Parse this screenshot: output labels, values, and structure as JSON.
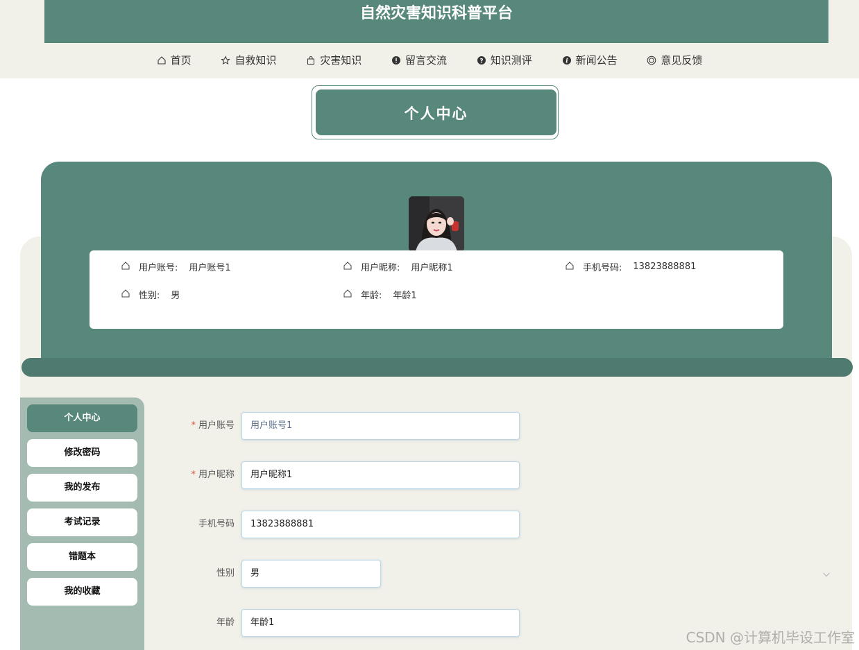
{
  "app": {
    "title": "自然灾害知识科普平台"
  },
  "nav": {
    "items": [
      {
        "label": "首页",
        "icon": "home-icon"
      },
      {
        "label": "自救知识",
        "icon": "star-icon"
      },
      {
        "label": "灾害知识",
        "icon": "bag-icon"
      },
      {
        "label": "留言交流",
        "icon": "alert-icon"
      },
      {
        "label": "知识测评",
        "icon": "help-icon"
      },
      {
        "label": "新闻公告",
        "icon": "info-icon"
      },
      {
        "label": "意见反馈",
        "icon": "smile-icon"
      }
    ]
  },
  "page": {
    "title": "个人中心"
  },
  "profile": {
    "fields": [
      {
        "label": "用户账号:",
        "value": "用户账号1"
      },
      {
        "label": "用户昵称:",
        "value": "用户昵称1"
      },
      {
        "label": "手机号码:",
        "value": "13823888881"
      },
      {
        "label": "性别:",
        "value": "男"
      },
      {
        "label": "年龄:",
        "value": "年龄1"
      }
    ]
  },
  "sidebar": {
    "items": [
      {
        "label": "个人中心",
        "active": true
      },
      {
        "label": "修改密码"
      },
      {
        "label": "我的发布"
      },
      {
        "label": "考试记录"
      },
      {
        "label": "错题本"
      },
      {
        "label": "我的收藏"
      }
    ]
  },
  "form": {
    "fields": [
      {
        "label": "用户账号",
        "required": true,
        "value": "用户账号1"
      },
      {
        "label": "用户昵称",
        "required": true,
        "value": "用户昵称1"
      },
      {
        "label": "手机号码",
        "required": false,
        "value": "13823888881"
      },
      {
        "label": "性别",
        "required": false,
        "value": "男"
      },
      {
        "label": "年龄",
        "required": false,
        "value": "年龄1"
      }
    ]
  },
  "watermark": "CSDN @计算机毕设工作室",
  "colors": {
    "primary": "#58887c",
    "cream": "#f1f0e9",
    "sidebar": "#a4bbb1",
    "required": "#e0563a"
  }
}
